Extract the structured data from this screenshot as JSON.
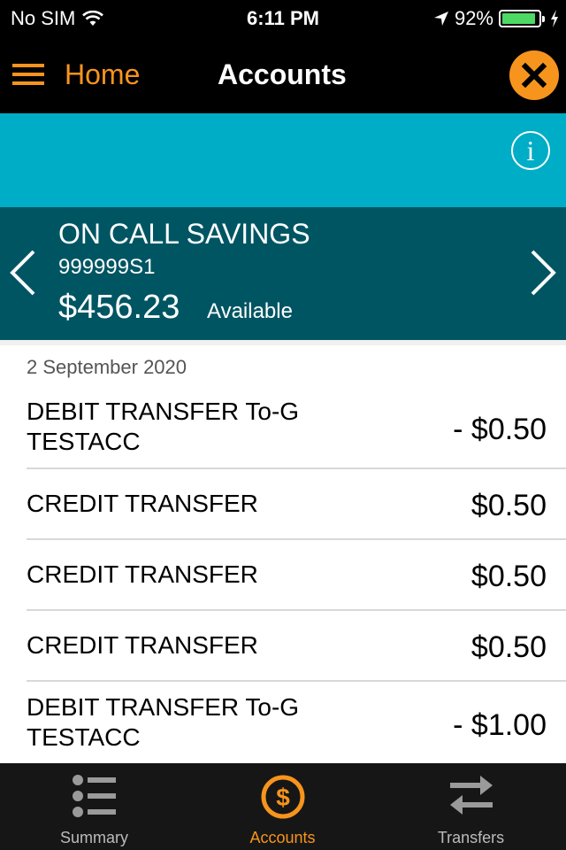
{
  "status_bar": {
    "carrier": "No SIM",
    "time": "6:11 PM",
    "battery_percent_label": "92%",
    "battery_level": 0.92,
    "battery_color": "#4cd964"
  },
  "nav": {
    "menu_icon": "hamburger-icon",
    "home_label": "Home",
    "title": "Accounts",
    "close_icon": "close-icon",
    "accent_color": "#f7941d"
  },
  "info": {
    "icon": "info-icon",
    "band_color": "#00adc6"
  },
  "account": {
    "name": "ON CALL SAVINGS",
    "number": "999999S1",
    "balance": "$456.23",
    "balance_label": "Available",
    "band_color": "#005563",
    "prev_icon": "chevron-left-icon",
    "next_icon": "chevron-right-icon"
  },
  "transactions": {
    "date": "2 September 2020",
    "items": [
      {
        "description": "DEBIT TRANSFER To-G TESTACC",
        "amount": "- $0.50"
      },
      {
        "description": "CREDIT TRANSFER",
        "amount": "$0.50"
      },
      {
        "description": "CREDIT TRANSFER",
        "amount": "$0.50"
      },
      {
        "description": "CREDIT TRANSFER",
        "amount": "$0.50"
      },
      {
        "description": "DEBIT TRANSFER To-G TESTACC",
        "amount": "- $1.00"
      }
    ]
  },
  "tab_bar": {
    "tabs": [
      {
        "label": "Summary",
        "icon": "list-icon",
        "active": false
      },
      {
        "label": "Accounts",
        "icon": "dollar-circle-icon",
        "active": true
      },
      {
        "label": "Transfers",
        "icon": "transfer-arrows-icon",
        "active": false
      }
    ]
  }
}
